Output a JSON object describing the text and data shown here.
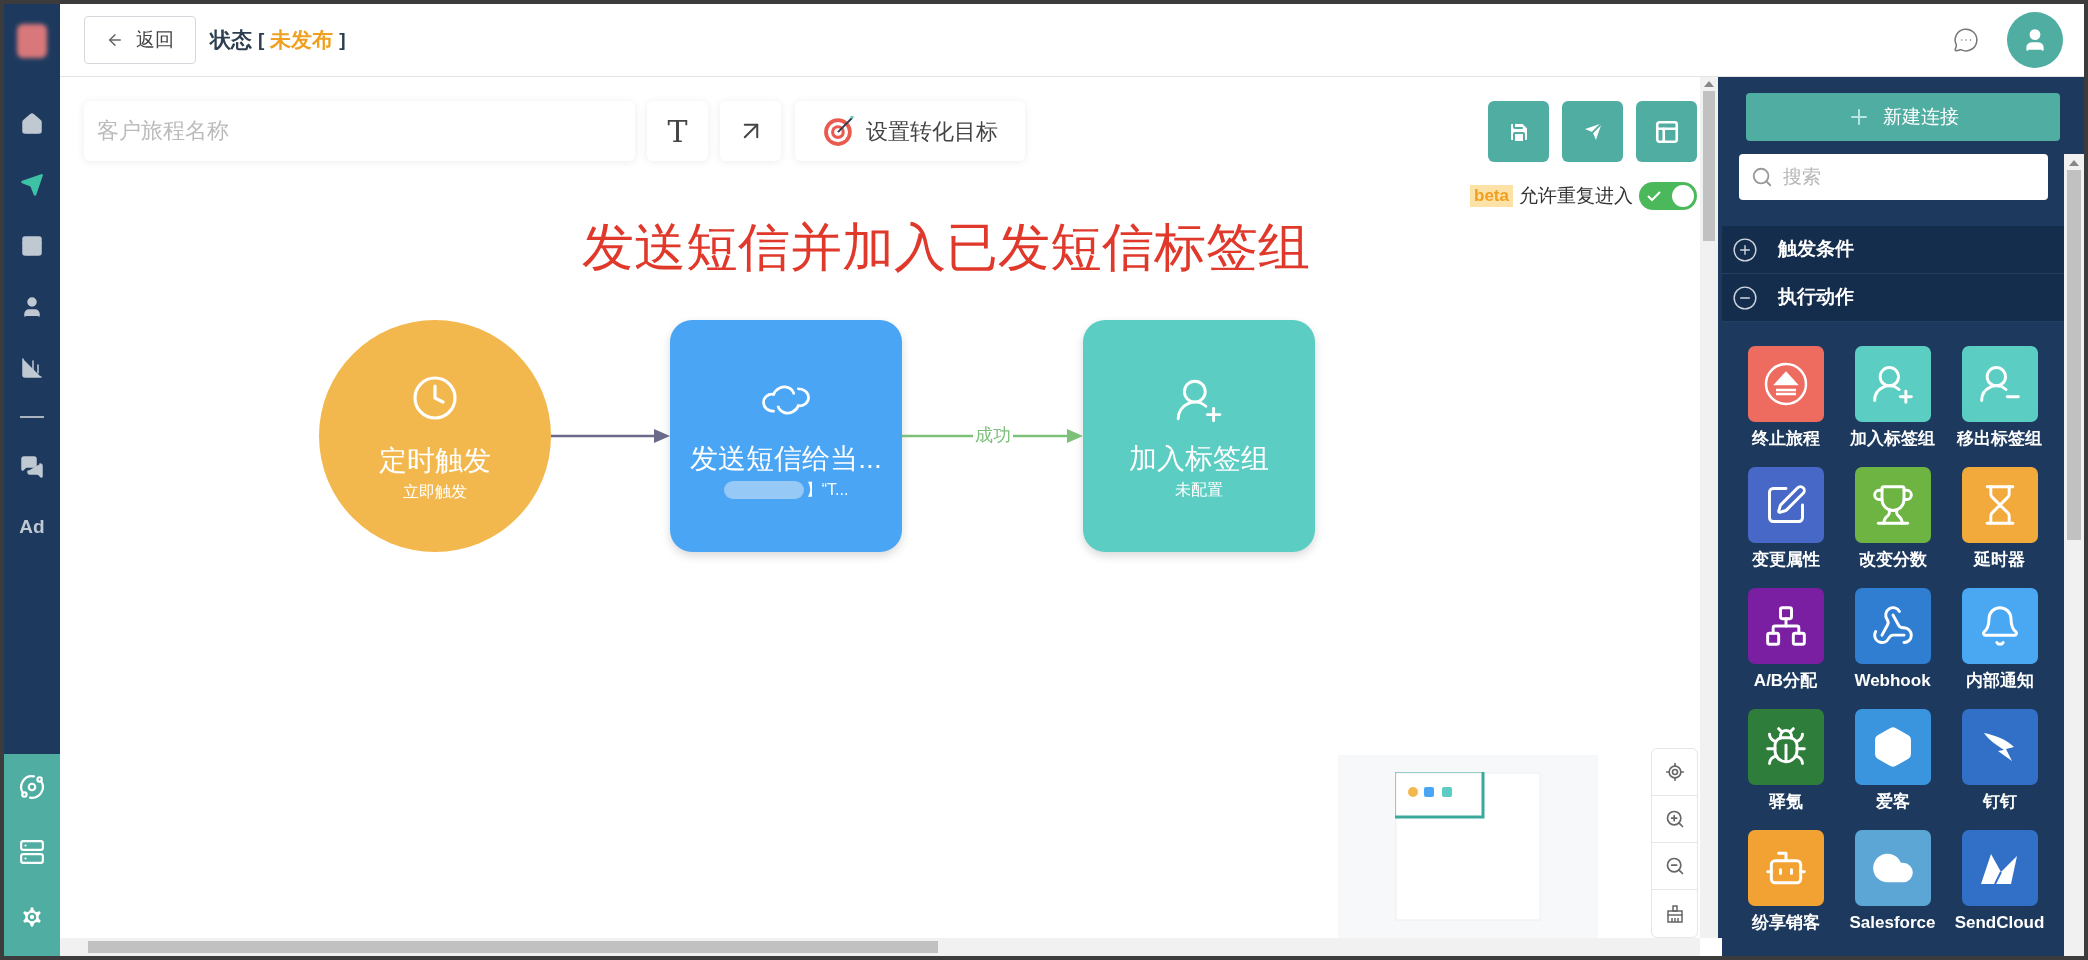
{
  "topbar": {
    "back_button": "返回",
    "status_label": "状态",
    "status_open": "[",
    "status_value": "未发布",
    "status_close": "]"
  },
  "sidebar": {
    "items": [
      {
        "kind": "icon",
        "selected": false
      },
      {
        "kind": "icon",
        "selected": true
      },
      {
        "kind": "icon",
        "selected": false
      },
      {
        "kind": "icon",
        "selected": false
      },
      {
        "kind": "icon",
        "selected": false
      },
      {
        "kind": "divider"
      },
      {
        "kind": "icon",
        "selected": false
      },
      {
        "kind": "text",
        "label": "Ad",
        "selected": false
      }
    ]
  },
  "toolbar": {
    "name_placeholder": "客户旅程名称",
    "text_tool": "T",
    "goal_button": "设置转化目标"
  },
  "repeat_entry": {
    "badge": "beta",
    "label": "允许重复进入",
    "on": true
  },
  "title": "发送短信并加入已发短信标签组",
  "nodes": [
    {
      "kind": "circle",
      "title": "定时触发",
      "subtitle": "立即触发",
      "color": "#f3b84d"
    },
    {
      "kind": "box",
      "title": "发送短信给当...",
      "subtitle": "】“T...",
      "redacted": true,
      "color": "#4aa5f5"
    },
    {
      "kind": "box",
      "title": "加入标签组",
      "subtitle": "未配置",
      "color": "#5ccdc2"
    }
  ],
  "edges": [
    {
      "color": "#6b6a8a"
    },
    {
      "label": "成功",
      "color": "#7cc07a"
    }
  ],
  "panel": {
    "new_connection": "新建连接",
    "search_placeholder": "搜索",
    "sections": [
      {
        "title": "触发条件",
        "expanded": false
      },
      {
        "title": "执行动作",
        "expanded": true,
        "actions": [
          {
            "label": "终止旅程",
            "color": "#ee6b60"
          },
          {
            "label": "加入标签组",
            "color": "#5ccdc2"
          },
          {
            "label": "移出标签组",
            "color": "#5ccdc2"
          },
          {
            "label": "变更属性",
            "color": "#4768c6"
          },
          {
            "label": "改变分数",
            "color": "#6db443"
          },
          {
            "label": "延时器",
            "color": "#f2aa3c"
          },
          {
            "label": "A/B分配",
            "color": "#7a1fa2"
          },
          {
            "label": "Webhook",
            "color": "#2f7ed2"
          },
          {
            "label": "内部通知",
            "color": "#4aa8f3"
          },
          {
            "label": "驿氪",
            "color": "#2e7d3a"
          },
          {
            "label": "爱客",
            "color": "#3a94de"
          },
          {
            "label": "钉钉",
            "color": "#3170c6"
          },
          {
            "label": "纷享销客",
            "color": "#f2a232"
          },
          {
            "label": "Salesforce",
            "color": "#5ca6d6"
          },
          {
            "label": "SendCloud",
            "color": "#3170c6"
          }
        ]
      }
    ]
  }
}
